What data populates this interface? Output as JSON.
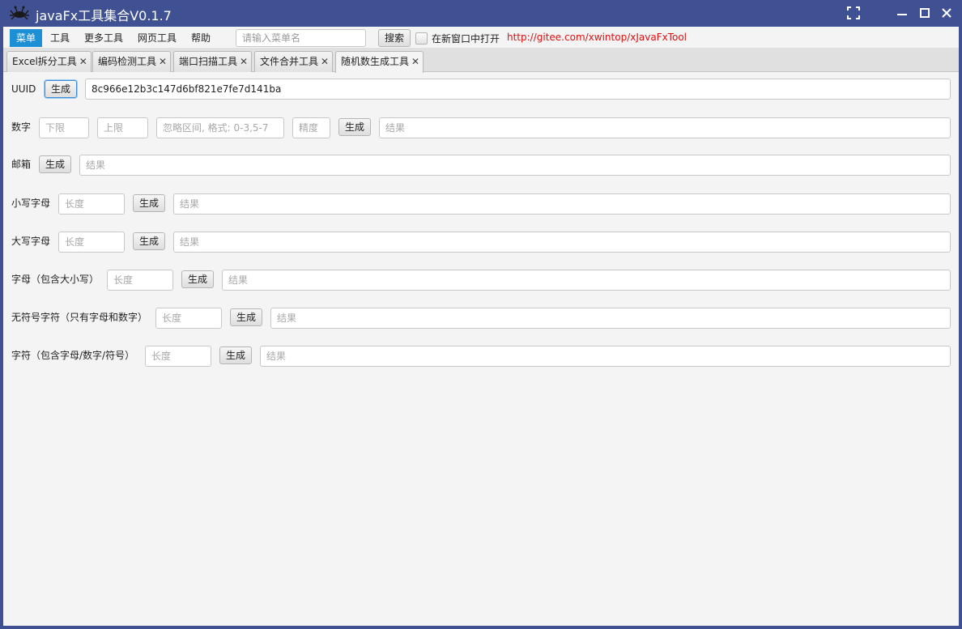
{
  "window": {
    "title": "javaFx工具集合V0.1.7",
    "app_icon": "crab-icon"
  },
  "menubar": {
    "items": [
      "菜单",
      "工具",
      "更多工具",
      "网页工具",
      "帮助"
    ],
    "active_index": 0,
    "search_placeholder": "请输入菜单名",
    "search_value": "",
    "search_button": "搜索",
    "new_window_label": "在新窗口中打开",
    "new_window_checked": false,
    "repo_link": "http://gitee.com/xwintop/xJavaFxTool"
  },
  "tabs": [
    {
      "label": "Excel拆分工具"
    },
    {
      "label": "编码检测工具"
    },
    {
      "label": "端口扫描工具"
    },
    {
      "label": "文件合并工具"
    },
    {
      "label": "随机数生成工具",
      "active": true
    }
  ],
  "tab_close_glyph": "✕",
  "form": {
    "generate_label": "生成",
    "result_placeholder": "结果",
    "length_placeholder": "长度",
    "uuid": {
      "label": "UUID",
      "result": "8c966e12b3c147d6bf821e7fe7d141ba"
    },
    "number": {
      "label": "数字",
      "lower_placeholder": "下限",
      "upper_placeholder": "上限",
      "ignore_placeholder": "忽略区间, 格式: 0-3,5-7",
      "precision_placeholder": "精度"
    },
    "email": {
      "label": "邮箱"
    },
    "lowercase": {
      "label": "小写字母"
    },
    "uppercase": {
      "label": "大写字母"
    },
    "letters": {
      "label": "字母（包含大小写）"
    },
    "alnum": {
      "label": "无符号字符（只有字母和数字）"
    },
    "chars": {
      "label": "字符（包含字母/数字/符号）"
    }
  }
}
